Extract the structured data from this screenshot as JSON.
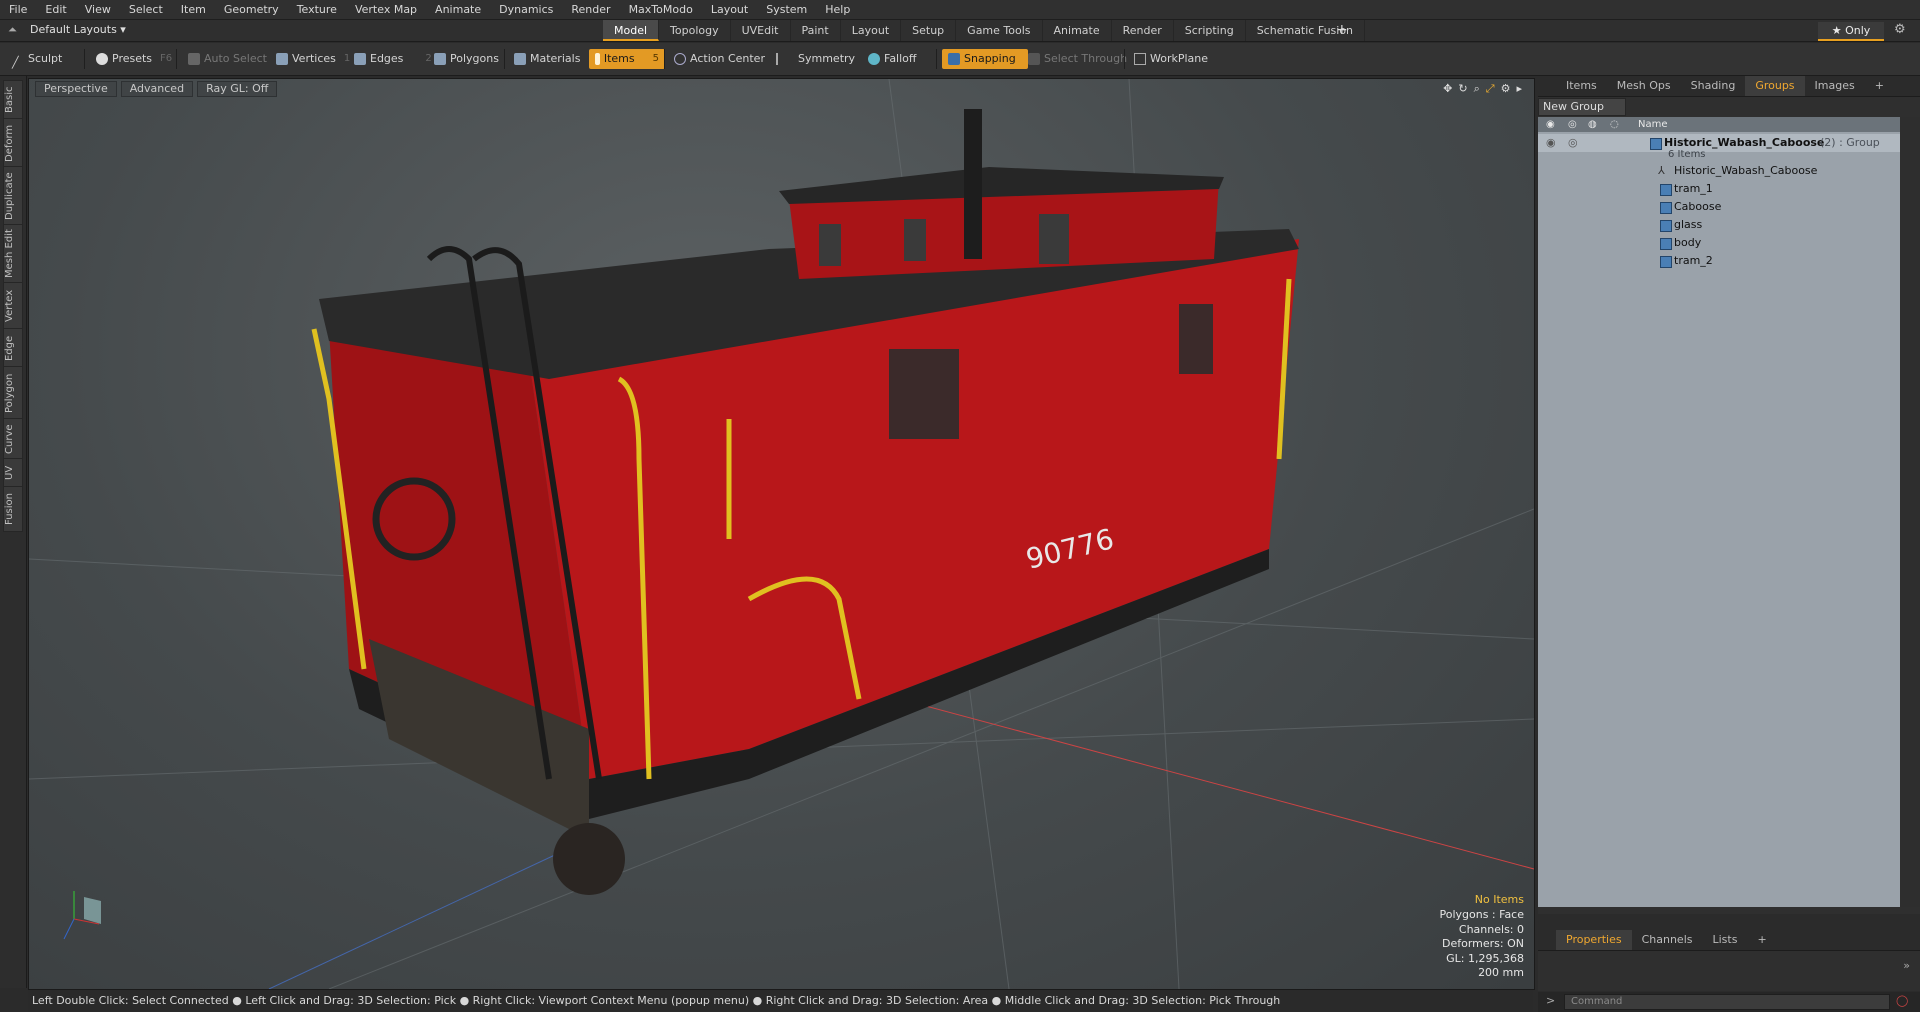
{
  "menu": [
    "File",
    "Edit",
    "View",
    "Select",
    "Item",
    "Geometry",
    "Texture",
    "Vertex Map",
    "Animate",
    "Dynamics",
    "Render",
    "MaxToModo",
    "Layout",
    "System",
    "Help"
  ],
  "layout_selector": "Default Layouts ▾",
  "tabs": [
    "Model",
    "Topology",
    "UVEdit",
    "Paint",
    "Layout",
    "Setup",
    "Game Tools",
    "Animate",
    "Render",
    "Scripting",
    "Schematic Fusion"
  ],
  "active_tab": "Model",
  "only_label": "★  Only",
  "toolbar": {
    "sculpt": "Sculpt",
    "presets": "Presets",
    "presets_key": "F6",
    "auto_select": "Auto Select",
    "vertices": "Vertices",
    "vertices_count": "1",
    "edges": "Edges",
    "edges_count": "2",
    "polygons": "Polygons",
    "materials": "Materials",
    "items": "Items",
    "items_count": "5",
    "action_center": "Action Center",
    "symmetry": "Symmetry",
    "falloff": "Falloff",
    "snapping": "Snapping",
    "select_through": "Select Through",
    "workplane": "WorkPlane"
  },
  "left_tabs": [
    "Basic",
    "Deform",
    "Duplicate",
    "Mesh Edit",
    "Vertex",
    "Edge",
    "Polygon",
    "Curve",
    "UV",
    "Fusion"
  ],
  "viewport": {
    "view": "Perspective",
    "shading": "Advanced",
    "raygl": "Ray GL: Off",
    "number_plate": "90776",
    "info": {
      "selection": "No Items",
      "polygons": "Polygons : Face",
      "channels": "Channels: 0",
      "deformers": "Deformers: ON",
      "gl": "GL: 1,295,368",
      "unit": "200 mm"
    }
  },
  "right_panel": {
    "tabs": [
      "Items",
      "Mesh Ops",
      "Shading",
      "Groups",
      "Images"
    ],
    "active_tab": "Groups",
    "new_group": "New Group",
    "column_name": "Name",
    "group": {
      "name": "Historic_Wabash_Caboose",
      "meta": "(2) : Group",
      "count": "6 Items",
      "children": [
        "Historic_Wabash_Caboose",
        "tram_1",
        "Caboose",
        "glass",
        "body",
        "tram_2"
      ]
    }
  },
  "props_tabs": [
    "Properties",
    "Channels",
    "Lists"
  ],
  "props_active": "Properties",
  "command_placeholder": "Command",
  "status": "Left Double Click: Select Connected ● Left Click and Drag: 3D Selection: Pick ● Right Click: Viewport Context Menu (popup menu) ● Right Click and Drag: 3D Selection: Area ● Middle Click and Drag: 3D Selection: Pick Through",
  "colors": {
    "accent": "#e8a020",
    "caboose_red": "#b8171a",
    "rail_yellow": "#e0c020"
  }
}
